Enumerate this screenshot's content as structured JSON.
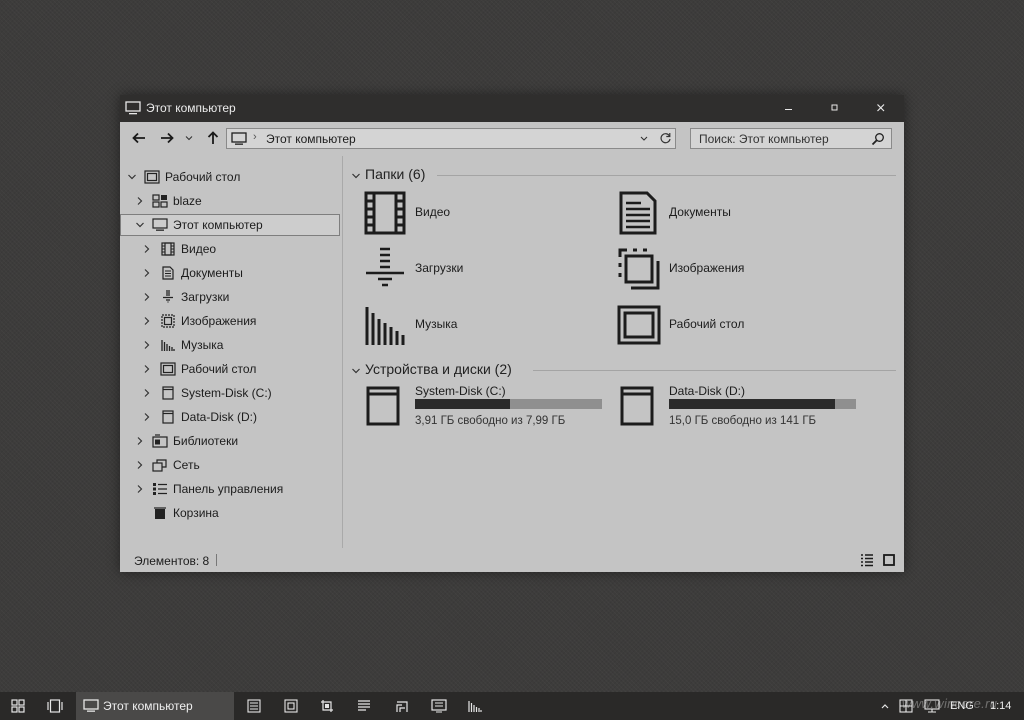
{
  "window": {
    "title": "Этот компьютер",
    "buttons": {
      "minimize": "minimize-icon",
      "maximize": "maximize-icon",
      "close": "close-icon"
    }
  },
  "toolbar": {
    "address": "Этот компьютер",
    "search_placeholder": "Поиск: Этот компьютер"
  },
  "sidebar": {
    "items": [
      {
        "label": "Рабочий стол"
      },
      {
        "label": "blaze"
      },
      {
        "label": "Этот компьютер"
      },
      {
        "label": "Видео"
      },
      {
        "label": "Документы"
      },
      {
        "label": "Загрузки"
      },
      {
        "label": "Изображения"
      },
      {
        "label": "Музыка"
      },
      {
        "label": "Рабочий стол"
      },
      {
        "label": "System-Disk (C:)"
      },
      {
        "label": "Data-Disk (D:)"
      },
      {
        "label": "Библиотеки"
      },
      {
        "label": "Сеть"
      },
      {
        "label": "Панель управления"
      },
      {
        "label": "Корзина"
      }
    ]
  },
  "content": {
    "folders_header": "Папки (6)",
    "folders": [
      {
        "label": "Видео"
      },
      {
        "label": "Документы"
      },
      {
        "label": "Загрузки"
      },
      {
        "label": "Изображения"
      },
      {
        "label": "Музыка"
      },
      {
        "label": "Рабочий стол"
      }
    ],
    "devices_header": "Устройства и диски (2)",
    "drives": [
      {
        "name": "System-Disk (C:)",
        "free_text": "3,91 ГБ свободно из 7,99 ГБ",
        "used_fraction": 0.51
      },
      {
        "name": "Data-Disk (D:)",
        "free_text": "15,0 ГБ свободно из 141 ГБ",
        "used_fraction": 0.89
      }
    ]
  },
  "statusbar": {
    "count": "Элементов: 8"
  },
  "taskbar": {
    "active_task": "Этот компьютер",
    "language": "ENG",
    "time": "1:14"
  },
  "watermark": "www.wincore.ru"
}
